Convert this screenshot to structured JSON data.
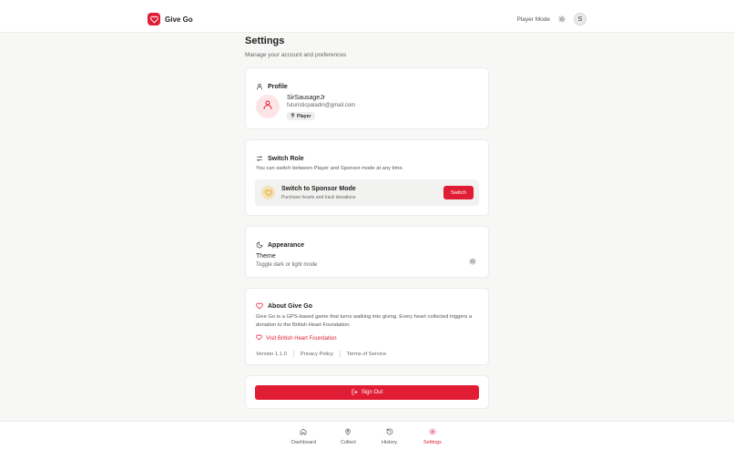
{
  "header": {
    "app_name": "Give Go",
    "mode_label": "Player Mode",
    "avatar_initial": "S"
  },
  "page": {
    "title": "Settings",
    "subtitle": "Manage your account and preferences"
  },
  "profile": {
    "title": "Profile",
    "username": "SirSausageJr",
    "email": "futuristicpaladin@gmail.com",
    "role_badge": "Player"
  },
  "switch_role": {
    "title": "Switch Role",
    "description": "You can switch between Player and Sponsor mode at any time.",
    "option_title": "Switch to Sponsor Mode",
    "option_subtitle": "Purchase hearts and track donations",
    "button_label": "Switch"
  },
  "appearance": {
    "title": "Appearance",
    "theme_label": "Theme",
    "theme_subtitle": "Toggle dark or light mode"
  },
  "about": {
    "title": "About Give Go",
    "text": "Give Go is a GPS-based game that turns walking into giving. Every heart collected triggers a donation to the British Heart Foundation.",
    "link_label": "Visit British Heart Foundation",
    "version": "Version 1.1.0",
    "privacy": "Privacy Policy",
    "terms": "Terms of Service"
  },
  "sign_out": {
    "label": "Sign Out"
  },
  "bottom_nav": {
    "items": [
      {
        "label": "Dashboard",
        "icon": "home-icon"
      },
      {
        "label": "Collect",
        "icon": "map-pin-icon"
      },
      {
        "label": "History",
        "icon": "history-icon"
      },
      {
        "label": "Settings",
        "icon": "gear-icon"
      }
    ],
    "active": "Settings"
  },
  "colors": {
    "accent": "#e11d36",
    "background": "#f7f7f6",
    "card": "#ffffff"
  }
}
